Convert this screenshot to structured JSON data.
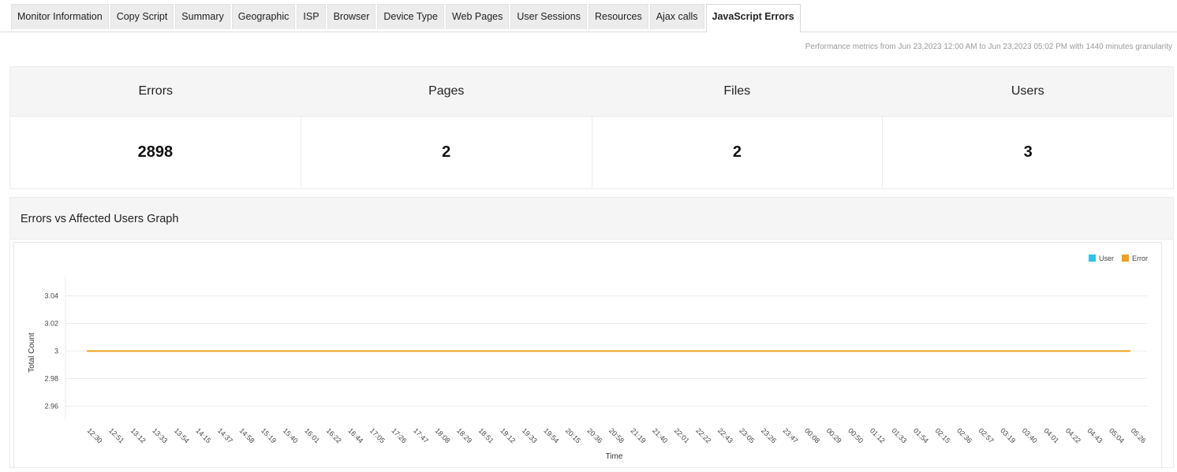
{
  "tabs": [
    {
      "label": "Monitor Information",
      "active": false
    },
    {
      "label": "Copy Script",
      "active": false
    },
    {
      "label": "Summary",
      "active": false
    },
    {
      "label": "Geographic",
      "active": false
    },
    {
      "label": "ISP",
      "active": false
    },
    {
      "label": "Browser",
      "active": false
    },
    {
      "label": "Device Type",
      "active": false
    },
    {
      "label": "Web Pages",
      "active": false
    },
    {
      "label": "User Sessions",
      "active": false
    },
    {
      "label": "Resources",
      "active": false
    },
    {
      "label": "Ajax calls",
      "active": false
    },
    {
      "label": "JavaScript Errors",
      "active": true
    }
  ],
  "perf_text": "Performance metrics from Jun 23,2023 12:00 AM to Jun 23,2023 05:02 PM with 1440 minutes granularity",
  "summary": {
    "headers": [
      "Errors",
      "Pages",
      "Files",
      "Users"
    ],
    "values": [
      "2898",
      "2",
      "2",
      "3"
    ]
  },
  "graph": {
    "title": "Errors vs Affected Users Graph"
  },
  "chart_data": {
    "type": "line",
    "xlabel": "Time",
    "ylabel": "Total Count",
    "ylim": [
      2.95,
      3.05
    ],
    "yticks": [
      3.04,
      3.02,
      3,
      2.98,
      2.96
    ],
    "ytick_labels": [
      "3.04",
      "3.02",
      "3",
      "2.98",
      "2.96"
    ],
    "x": [
      "12:30",
      "12:51",
      "13:12",
      "13:33",
      "13:54",
      "14:15",
      "14:37",
      "14:58",
      "15:19",
      "15:40",
      "16:01",
      "16:22",
      "16:44",
      "17:05",
      "17:26",
      "17:47",
      "18:08",
      "18:29",
      "18:51",
      "19:12",
      "19:33",
      "19:54",
      "20:15",
      "20:36",
      "20:58",
      "21:19",
      "21:40",
      "22:01",
      "22:22",
      "22:43",
      "23:05",
      "23:26",
      "23:47",
      "00:08",
      "00:29",
      "00:50",
      "01:12",
      "01:33",
      "01:54",
      "02:15",
      "02:36",
      "02:57",
      "03:19",
      "03:40",
      "04:01",
      "04:22",
      "04:43",
      "05:04",
      "05:26"
    ],
    "series": [
      {
        "name": "User",
        "color": "#2ec3e8",
        "values": [
          3,
          3,
          3,
          3,
          3,
          3,
          3,
          3,
          3,
          3,
          3,
          3,
          3,
          3,
          3,
          3,
          3,
          3,
          3,
          3,
          3,
          3,
          3,
          3,
          3,
          3,
          3,
          3,
          3,
          3,
          3,
          3,
          3,
          3,
          3,
          3,
          3,
          3,
          3,
          3,
          3,
          3,
          3,
          3,
          3,
          3,
          3,
          3,
          3
        ]
      },
      {
        "name": "Error",
        "color": "#f0a020",
        "values": [
          3,
          3,
          3,
          3,
          3,
          3,
          3,
          3,
          3,
          3,
          3,
          3,
          3,
          3,
          3,
          3,
          3,
          3,
          3,
          3,
          3,
          3,
          3,
          3,
          3,
          3,
          3,
          3,
          3,
          3,
          3,
          3,
          3,
          3,
          3,
          3,
          3,
          3,
          3,
          3,
          3,
          3,
          3,
          3,
          3,
          3,
          3,
          3,
          3
        ]
      }
    ],
    "legend_position": "top-right",
    "grid": true
  }
}
